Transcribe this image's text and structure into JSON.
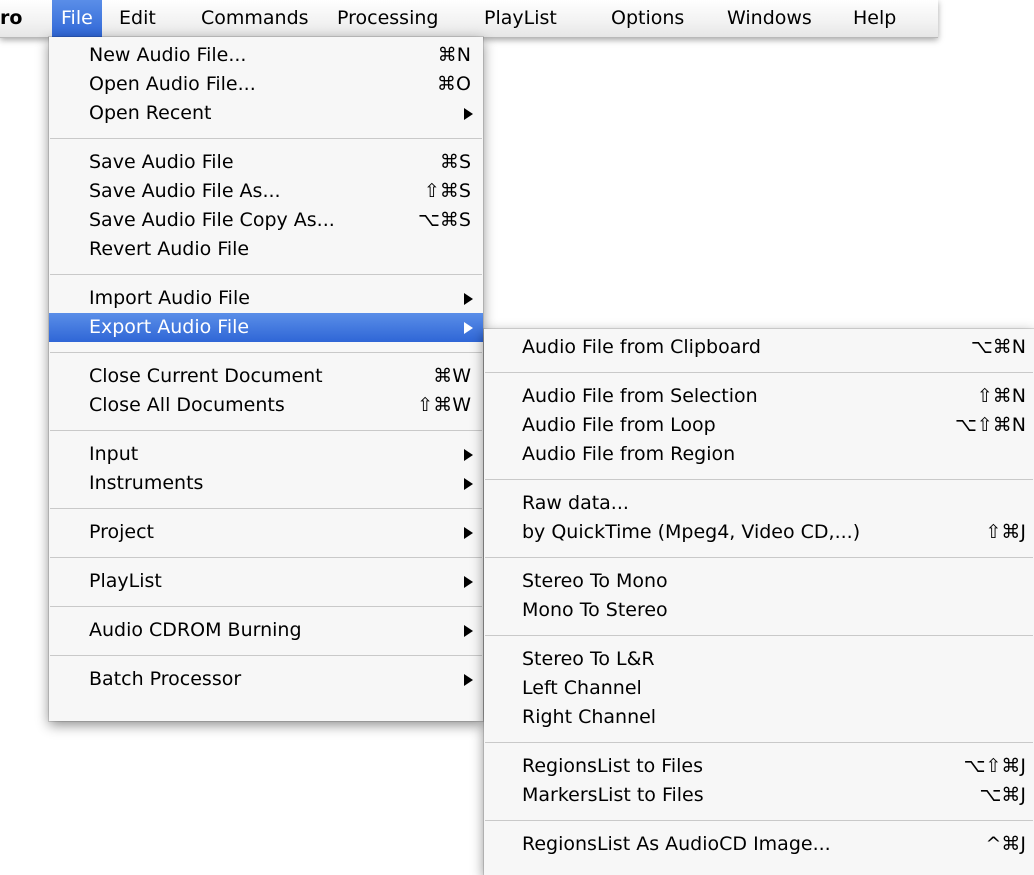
{
  "menubar": {
    "app": "ro",
    "items": [
      "File",
      "Edit",
      "Commands",
      "Processing",
      "PlayList",
      "Options",
      "Windows",
      "Help"
    ]
  },
  "file_menu": [
    {
      "type": "item",
      "label": "New Audio File...",
      "shortcut": "⌘N"
    },
    {
      "type": "item",
      "label": "Open Audio File...",
      "shortcut": "⌘O"
    },
    {
      "type": "item",
      "label": "Open Recent",
      "submenu": true
    },
    {
      "type": "sep"
    },
    {
      "type": "item",
      "label": "Save Audio File",
      "shortcut": "⌘S"
    },
    {
      "type": "item",
      "label": "Save Audio File As...",
      "shortcut": "⇧⌘S"
    },
    {
      "type": "item",
      "label": "Save Audio File Copy As...",
      "shortcut": "⌥⌘S"
    },
    {
      "type": "item",
      "label": "Revert Audio File"
    },
    {
      "type": "sep"
    },
    {
      "type": "item",
      "label": "Import Audio File",
      "submenu": true
    },
    {
      "type": "item",
      "label": "Export Audio File",
      "submenu": true,
      "highlighted": true
    },
    {
      "type": "sep"
    },
    {
      "type": "item",
      "label": "Close Current Document",
      "shortcut": "⌘W"
    },
    {
      "type": "item",
      "label": "Close All Documents",
      "shortcut": "⇧⌘W"
    },
    {
      "type": "sep"
    },
    {
      "type": "item",
      "label": "Input",
      "submenu": true
    },
    {
      "type": "item",
      "label": "Instruments",
      "submenu": true
    },
    {
      "type": "sep"
    },
    {
      "type": "item",
      "label": "Project",
      "submenu": true
    },
    {
      "type": "sep"
    },
    {
      "type": "item",
      "label": "PlayList",
      "submenu": true
    },
    {
      "type": "sep"
    },
    {
      "type": "item",
      "label": "Audio CDROM Burning",
      "submenu": true
    },
    {
      "type": "sep"
    },
    {
      "type": "item",
      "label": "Batch Processor",
      "submenu": true
    }
  ],
  "export_submenu": [
    {
      "type": "item",
      "label": "Audio File from Clipboard",
      "shortcut": "⌥⌘N"
    },
    {
      "type": "sep"
    },
    {
      "type": "item",
      "label": "Audio File from Selection",
      "shortcut": "⇧⌘N"
    },
    {
      "type": "item",
      "label": "Audio File from Loop",
      "shortcut": "⌥⇧⌘N"
    },
    {
      "type": "item",
      "label": "Audio File from Region"
    },
    {
      "type": "sep"
    },
    {
      "type": "item",
      "label": "Raw data..."
    },
    {
      "type": "item",
      "label": "by QuickTime (Mpeg4, Video CD,...)",
      "shortcut": "⇧⌘J"
    },
    {
      "type": "sep"
    },
    {
      "type": "item",
      "label": "Stereo To Mono"
    },
    {
      "type": "item",
      "label": "Mono To Stereo"
    },
    {
      "type": "sep"
    },
    {
      "type": "item",
      "label": "Stereo To L&R"
    },
    {
      "type": "item",
      "label": "Left Channel"
    },
    {
      "type": "item",
      "label": "Right Channel"
    },
    {
      "type": "sep"
    },
    {
      "type": "item",
      "label": "RegionsList to Files",
      "shortcut": "⌥⇧⌘J"
    },
    {
      "type": "item",
      "label": "MarkersList to Files",
      "shortcut": "⌥⌘J"
    },
    {
      "type": "sep"
    },
    {
      "type": "item",
      "label": "RegionsList As AudioCD Image...",
      "shortcut": "^⌘J"
    }
  ]
}
